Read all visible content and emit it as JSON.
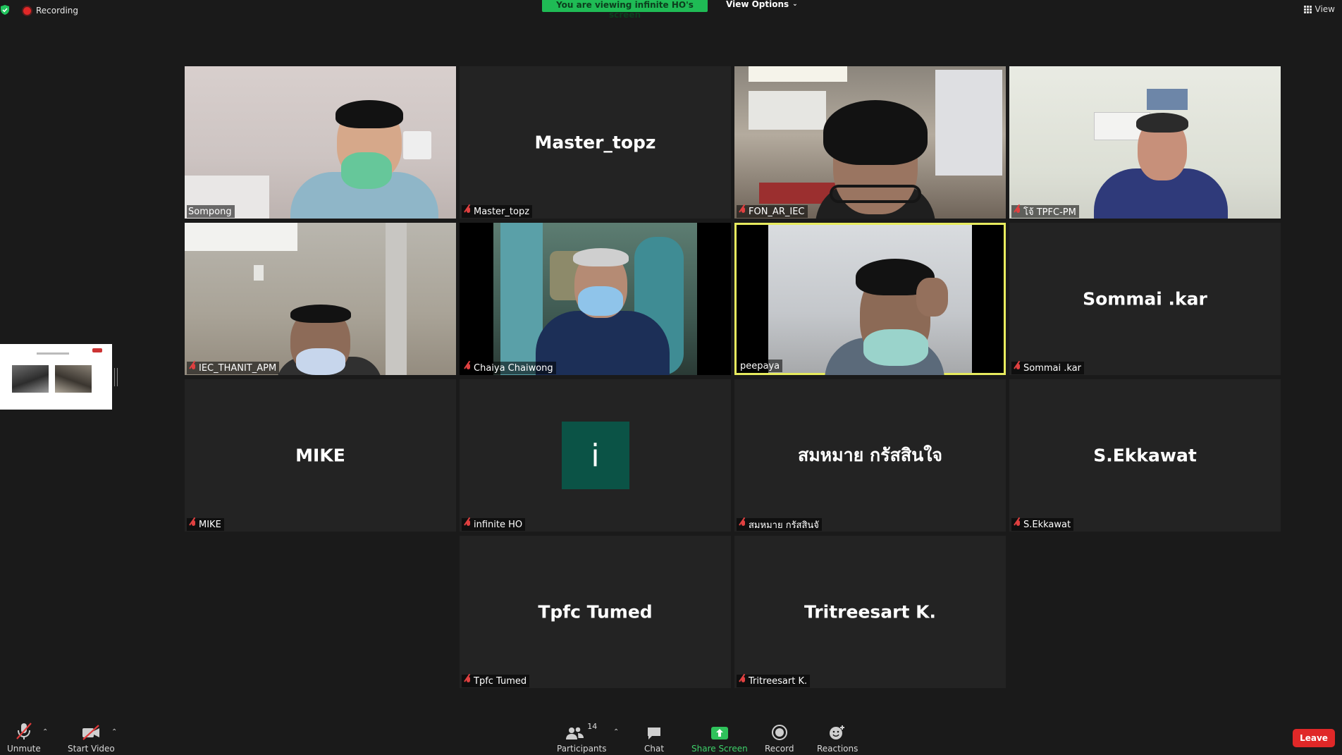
{
  "topbar": {
    "recording_label": "Recording",
    "viewing_banner": "You are viewing infinite HO's screen",
    "view_options_label": "View Options",
    "view_label": "View"
  },
  "tiles": [
    {
      "name": "Sompong",
      "display": "",
      "video": true
    },
    {
      "name": "Master_topz",
      "display": "Master_topz",
      "video": false
    },
    {
      "name": "FON_AR_IEC",
      "display": "",
      "video": true
    },
    {
      "name": "โจ้ TPFC-PM",
      "display": "",
      "video": true
    },
    {
      "name": "IEC_THANIT_APM",
      "display": "",
      "video": true
    },
    {
      "name": "Chaiya Chaiwong",
      "display": "",
      "video": true
    },
    {
      "name": "peepaya",
      "display": "",
      "video": true,
      "active_speaker": true
    },
    {
      "name": "Sommai .kar",
      "display": "Sommai .kar",
      "video": false
    },
    {
      "name": "MIKE",
      "display": "MIKE",
      "video": false
    },
    {
      "name": "infinite HO",
      "display": "",
      "avatar_letter": "i",
      "video": false
    },
    {
      "name": "สมหมาย กรัสสินจั",
      "display": "สมหมาย กรัสสินใจ",
      "video": false
    },
    {
      "name": "S.Ekkawat",
      "display": "S.Ekkawat",
      "video": false
    },
    {
      "name": "Tpfc Tumed",
      "display": "Tpfc Tumed",
      "video": false
    },
    {
      "name": "Tritreesart K.",
      "display": "Tritreesart K.",
      "video": false
    }
  ],
  "toolbar": {
    "unmute_label": "Unmute",
    "start_video_label": "Start Video",
    "participants_label": "Participants",
    "participants_count": "14",
    "chat_label": "Chat",
    "share_screen_label": "Share Screen",
    "record_label": "Record",
    "reactions_label": "Reactions",
    "leave_label": "Leave"
  },
  "colors": {
    "banner": "#1fbb55",
    "active_border": "#e7eb5e",
    "leave": "#e02828",
    "avatar_bg": "#0b5346"
  }
}
